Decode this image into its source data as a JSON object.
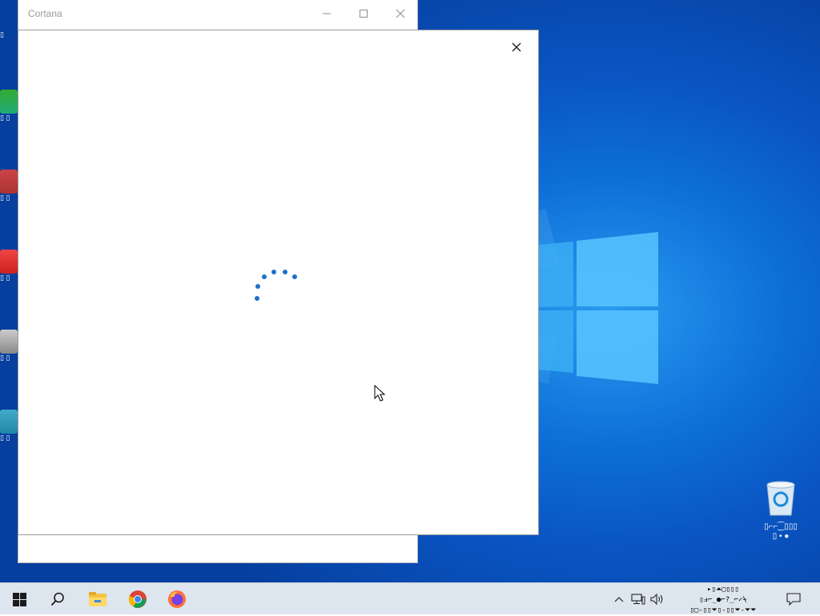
{
  "desktop": {
    "left_icon_labels": [
      "▯",
      "▯ ▯",
      "▯ ▯",
      "▯ ▯",
      "▯ ▯",
      "▯ ▯"
    ],
    "recycle_bin_label": "▯⌐⌐⁐▯▯▯\n▯ • ●"
  },
  "cortana_window": {
    "title": "Cortana",
    "minimize_label": "—",
    "maximize_label": "☐",
    "close_label": "✕"
  },
  "dialog": {
    "close_label": "✕",
    "status": "loading"
  },
  "taskbar": {
    "start_icon": "windows-logo-icon",
    "search_icon": "search-icon",
    "pinned": [
      "file-explorer-icon",
      "chrome-icon",
      "firefox-icon"
    ],
    "tray": {
      "chevron": "^",
      "network": "network-icon",
      "volume": "volume-icon"
    },
    "clock_text": "▸▯⏶▢▯▯▯\n▯ⅎ⌐_●⌐?_⌐✓⍀\n▯▢-▯▯⏷▯-▯▯⏷-⏷⏷",
    "notification_icon": "notification-icon"
  },
  "colors": {
    "accent": "#1a73c8",
    "desktop_blue": "#0a56c4",
    "taskbar": "#dde6ee"
  }
}
